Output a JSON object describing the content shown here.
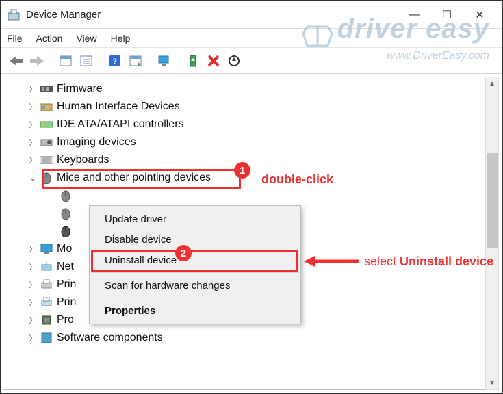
{
  "window": {
    "title": "Device Manager",
    "buttons": {
      "min": "—",
      "max": "☐",
      "close": "✕"
    }
  },
  "menu": {
    "file": "File",
    "action": "Action",
    "view": "View",
    "help": "Help"
  },
  "toolbar": {
    "back": "back",
    "forward": "forward",
    "tree1": "show-hidden",
    "tree2": "devices-by-type",
    "help": "help",
    "prop": "properties",
    "monitor": "update",
    "usb": "enable",
    "remove": "uninstall",
    "scan": "scan"
  },
  "tree": {
    "items": {
      "firmware": "Firmware",
      "hid": "Human Interface Devices",
      "ide": "IDE ATA/ATAPI controllers",
      "imaging": "Imaging devices",
      "keyboards": "Keyboards",
      "mice": "Mice and other pointing devices",
      "mon": "Mo",
      "net": "Net",
      "printq": "Prin",
      "printers": "Prin",
      "proc": "Pro",
      "softcomp": "Software components"
    }
  },
  "context_menu": {
    "update": "Update driver",
    "disable": "Disable device",
    "uninstall": "Uninstall device",
    "scan": "Scan for hardware changes",
    "properties": "Properties"
  },
  "annotations": {
    "badge1": "1",
    "badge2": "2",
    "label1": "double-click",
    "label2a": "select ",
    "label2b": "Uninstall device"
  },
  "watermark": {
    "line1": "driver easy",
    "line2": "www.DriverEasy.com"
  }
}
